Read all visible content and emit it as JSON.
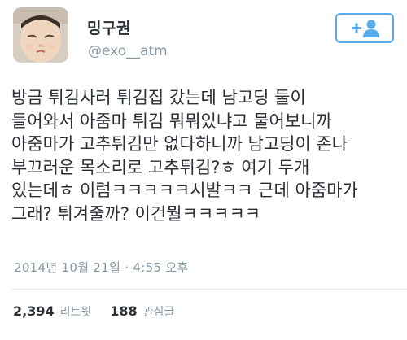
{
  "user": {
    "display_name": "밍구권",
    "handle": "@exo__atm"
  },
  "follow_button": {
    "icon": "add-user-icon",
    "accent_color": "#55acee"
  },
  "tweet": {
    "lines": [
      "방금 튀김사러 튀김집 갔는데 남고딩 둘이",
      "들어와서 아줌마 튀김 뭐뭐있냐고 물어보니까",
      "아줌마가 고추튀김만 없다하니까 남고딩이 존나",
      "부끄러운 목소리로 고추튀김?ㅎ 여기 두개",
      "있는데ㅎ 이럼ㅋㅋㅋㅋㅋ시발ㅋㅋ 근데 아줌마가",
      "그래? 튀겨줄까? 이건뭘ㅋㅋㅋㅋㅋ"
    ],
    "timestamp": "2014년 10월 21일 · 4:55 오후"
  },
  "stats": {
    "retweets_count": "2,394",
    "retweets_label": "리트윗",
    "likes_count": "188",
    "likes_label": "관심글"
  }
}
